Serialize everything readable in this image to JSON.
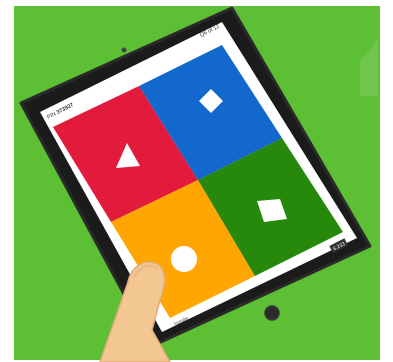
{
  "colors": {
    "background": "#5cbf34",
    "tablet_body": "#1b1b1b",
    "screen": "#ffffff",
    "answer_red": "#e21b3c",
    "answer_blue": "#1368ce",
    "answer_yellow": "#ffa602",
    "answer_green": "#26890c",
    "hand": "#f3c792"
  },
  "header": {
    "pin_label": "PIN",
    "pin_value": "373927",
    "question_counter": "Q6 of 12"
  },
  "answers": [
    {
      "color": "red",
      "shape": "triangle-icon"
    },
    {
      "color": "blue",
      "shape": "diamond-icon"
    },
    {
      "color": "yellow",
      "shape": "circle-icon"
    },
    {
      "color": "green",
      "shape": "square-icon"
    }
  ],
  "footer": {
    "nickname": "Natalie",
    "score": "6,233"
  }
}
